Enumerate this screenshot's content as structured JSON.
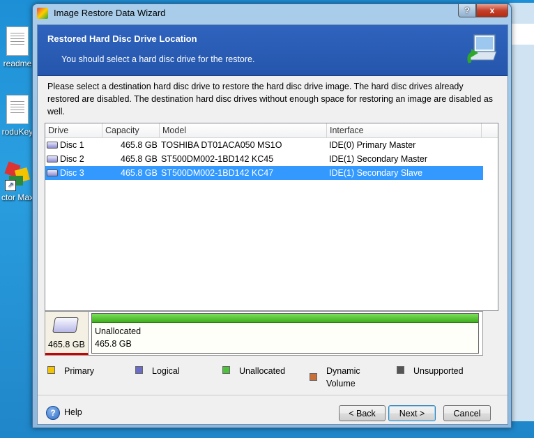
{
  "desktop": {
    "icons": [
      {
        "label": "readme"
      },
      {
        "label": "roduKey"
      },
      {
        "label": "ctor Max"
      }
    ]
  },
  "window": {
    "title": "Image Restore Data Wizard",
    "help_btn": "?",
    "close_btn": "x"
  },
  "banner": {
    "title": "Restored Hard Disc Drive Location",
    "subtitle": "You should select a hard disc drive for the restore."
  },
  "intro": "Please select a destination hard disc drive to restore the hard disc drive image. The hard disc drives already restored are disabled. The destination hard disc drives without enough space for restoring an image are disabled as well.",
  "table": {
    "columns": [
      "Drive",
      "Capacity",
      "Model",
      "Interface"
    ],
    "rows": [
      {
        "drive": "Disc 1",
        "capacity": "465.8 GB",
        "model": "TOSHIBA DT01ACA050 MS1O",
        "interface": "IDE(0) Primary Master",
        "selected": false
      },
      {
        "drive": "Disc 2",
        "capacity": "465.8 GB",
        "model": "ST500DM002-1BD142 KC45",
        "interface": "IDE(1) Secondary Master",
        "selected": false
      },
      {
        "drive": "Disc 3",
        "capacity": "465.8 GB",
        "model": "ST500DM002-1BD142 KC47",
        "interface": "IDE(1) Secondary Slave",
        "selected": true
      }
    ]
  },
  "diskmap": {
    "disk_size": "465.8 GB",
    "partition_label": "Unallocated",
    "partition_size": "465.8 GB"
  },
  "legend": [
    {
      "label": "Primary",
      "color": "#f5c400"
    },
    {
      "label": "Logical",
      "color": "#6b6bc8"
    },
    {
      "label": "Unallocated",
      "color": "#4cc23a"
    },
    {
      "label": "Dynamic Volume",
      "color": "#c8703a"
    },
    {
      "label": "Unsupported",
      "color": "#555555"
    }
  ],
  "footer": {
    "help": "Help",
    "back": "< Back",
    "next": "Next >",
    "cancel": "Cancel"
  }
}
